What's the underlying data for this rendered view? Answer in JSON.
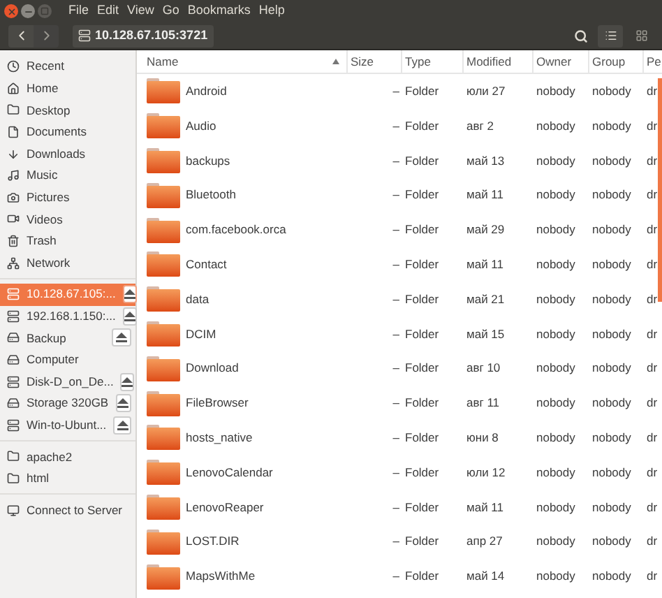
{
  "window": {
    "menu": [
      "File",
      "Edit",
      "View",
      "Go",
      "Bookmarks",
      "Help"
    ]
  },
  "toolbar": {
    "location": "10.128.67.105:3721"
  },
  "sidebar": {
    "sections": [
      {
        "items": [
          {
            "label": "Recent",
            "selected": false,
            "eject": false
          },
          {
            "label": "Home",
            "selected": false,
            "eject": false
          },
          {
            "label": "Desktop",
            "selected": false,
            "eject": false
          },
          {
            "label": "Documents",
            "selected": false,
            "eject": false
          },
          {
            "label": "Downloads",
            "selected": false,
            "eject": false
          },
          {
            "label": "Music",
            "selected": false,
            "eject": false
          },
          {
            "label": "Pictures",
            "selected": false,
            "eject": false
          },
          {
            "label": "Videos",
            "selected": false,
            "eject": false
          },
          {
            "label": "Trash",
            "selected": false,
            "eject": false
          },
          {
            "label": "Network",
            "selected": false,
            "eject": false
          }
        ]
      },
      {
        "items": [
          {
            "label": "10.128.67.105:...",
            "selected": true,
            "eject": true
          },
          {
            "label": "192.168.1.150:...",
            "selected": false,
            "eject": true
          },
          {
            "label": "Backup",
            "selected": false,
            "eject": true
          },
          {
            "label": "Computer",
            "selected": false,
            "eject": false
          },
          {
            "label": "Disk-D_on_De...",
            "selected": false,
            "eject": true
          },
          {
            "label": "Storage 320GB",
            "selected": false,
            "eject": true
          },
          {
            "label": "Win-to-Ubunt...",
            "selected": false,
            "eject": true
          }
        ]
      },
      {
        "items": [
          {
            "label": "apache2",
            "selected": false,
            "eject": false
          },
          {
            "label": "html",
            "selected": false,
            "eject": false
          }
        ]
      },
      {
        "items": [
          {
            "label": "Connect to Server",
            "selected": false,
            "eject": false
          }
        ]
      }
    ]
  },
  "table": {
    "columns": [
      {
        "label": "Name",
        "sorted": true
      },
      {
        "label": "Size",
        "sorted": false
      },
      {
        "label": "Type",
        "sorted": false
      },
      {
        "label": "Modified",
        "sorted": false
      },
      {
        "label": "Owner",
        "sorted": false
      },
      {
        "label": "Group",
        "sorted": false
      },
      {
        "label": "Pe",
        "sorted": false
      }
    ],
    "rows": [
      {
        "name": "Android",
        "size": "–",
        "type": "Folder",
        "modified": "юли 27",
        "owner": "nobody",
        "group": "nobody",
        "column_7": "dr"
      },
      {
        "name": "Audio",
        "size": "–",
        "type": "Folder",
        "modified": "авг 2",
        "owner": "nobody",
        "group": "nobody",
        "column_7": "dr"
      },
      {
        "name": "backups",
        "size": "–",
        "type": "Folder",
        "modified": "май 13",
        "owner": "nobody",
        "group": "nobody",
        "column_7": "dr"
      },
      {
        "name": "Bluetooth",
        "size": "–",
        "type": "Folder",
        "modified": "май 11",
        "owner": "nobody",
        "group": "nobody",
        "column_7": "dr"
      },
      {
        "name": "com.facebook.orca",
        "size": "–",
        "type": "Folder",
        "modified": "май 29",
        "owner": "nobody",
        "group": "nobody",
        "column_7": "dr"
      },
      {
        "name": "Contact",
        "size": "–",
        "type": "Folder",
        "modified": "май 11",
        "owner": "nobody",
        "group": "nobody",
        "column_7": "dr"
      },
      {
        "name": "data",
        "size": "–",
        "type": "Folder",
        "modified": "май 21",
        "owner": "nobody",
        "group": "nobody",
        "column_7": "dr"
      },
      {
        "name": "DCIM",
        "size": "–",
        "type": "Folder",
        "modified": "май 15",
        "owner": "nobody",
        "group": "nobody",
        "column_7": "dr"
      },
      {
        "name": "Download",
        "size": "–",
        "type": "Folder",
        "modified": "авг 10",
        "owner": "nobody",
        "group": "nobody",
        "column_7": "dr"
      },
      {
        "name": "FileBrowser",
        "size": "–",
        "type": "Folder",
        "modified": "авг 11",
        "owner": "nobody",
        "group": "nobody",
        "column_7": "dr"
      },
      {
        "name": "hosts_native",
        "size": "–",
        "type": "Folder",
        "modified": "юни 8",
        "owner": "nobody",
        "group": "nobody",
        "column_7": "dr"
      },
      {
        "name": "LenovoCalendar",
        "size": "–",
        "type": "Folder",
        "modified": "юли 12",
        "owner": "nobody",
        "group": "nobody",
        "column_7": "dr"
      },
      {
        "name": "LenovoReaper",
        "size": "–",
        "type": "Folder",
        "modified": "май 11",
        "owner": "nobody",
        "group": "nobody",
        "column_7": "dr"
      },
      {
        "name": "LOST.DIR",
        "size": "–",
        "type": "Folder",
        "modified": "апр 27",
        "owner": "nobody",
        "group": "nobody",
        "column_7": "dr"
      },
      {
        "name": "MapsWithMe",
        "size": "–",
        "type": "Folder",
        "modified": "май 14",
        "owner": "nobody",
        "group": "nobody",
        "column_7": "dr"
      }
    ]
  }
}
